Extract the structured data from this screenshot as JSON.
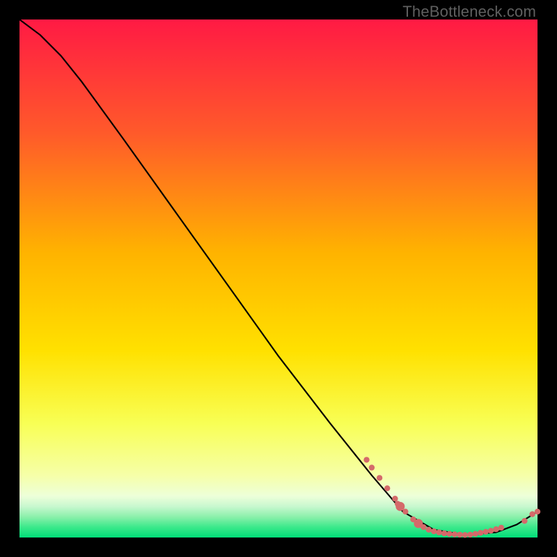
{
  "watermark": "TheBottleneck.com",
  "colors": {
    "top": "#ff1a44",
    "mid_upper": "#ff8a1f",
    "mid": "#ffd400",
    "mid_lower": "#f7ff5a",
    "pale": "#f4ffcf",
    "green_light": "#8ef5a4",
    "green": "#00e07a",
    "dot": "#d46a6a",
    "line": "#000000"
  },
  "chart_data": {
    "type": "line",
    "title": "",
    "xlabel": "",
    "ylabel": "",
    "xlim": [
      0,
      100
    ],
    "ylim": [
      0,
      100
    ],
    "curve": [
      {
        "x": 0,
        "y": 100
      },
      {
        "x": 4,
        "y": 97
      },
      {
        "x": 8,
        "y": 93
      },
      {
        "x": 12,
        "y": 88
      },
      {
        "x": 20,
        "y": 77
      },
      {
        "x": 30,
        "y": 63
      },
      {
        "x": 40,
        "y": 49
      },
      {
        "x": 50,
        "y": 35
      },
      {
        "x": 60,
        "y": 22
      },
      {
        "x": 68,
        "y": 12
      },
      {
        "x": 74,
        "y": 5
      },
      {
        "x": 80,
        "y": 1.5
      },
      {
        "x": 86,
        "y": 0.5
      },
      {
        "x": 92,
        "y": 1
      },
      {
        "x": 96,
        "y": 2.5
      },
      {
        "x": 100,
        "y": 5
      }
    ],
    "dots_small": [
      {
        "x": 67,
        "y": 15
      },
      {
        "x": 68,
        "y": 13.5
      },
      {
        "x": 69.5,
        "y": 11.5
      },
      {
        "x": 71,
        "y": 9.5
      },
      {
        "x": 72.5,
        "y": 7.5
      },
      {
        "x": 73,
        "y": 6.5
      },
      {
        "x": 74.5,
        "y": 5
      },
      {
        "x": 76,
        "y": 3.5
      },
      {
        "x": 78,
        "y": 2
      },
      {
        "x": 79,
        "y": 1.5
      },
      {
        "x": 80,
        "y": 1.2
      },
      {
        "x": 81,
        "y": 1
      },
      {
        "x": 82,
        "y": 0.8
      },
      {
        "x": 83,
        "y": 0.7
      },
      {
        "x": 84,
        "y": 0.6
      },
      {
        "x": 85,
        "y": 0.55
      },
      {
        "x": 86,
        "y": 0.5
      },
      {
        "x": 87,
        "y": 0.55
      },
      {
        "x": 88,
        "y": 0.7
      },
      {
        "x": 89,
        "y": 0.9
      },
      {
        "x": 90,
        "y": 1.1
      },
      {
        "x": 91,
        "y": 1.3
      },
      {
        "x": 92,
        "y": 1.6
      },
      {
        "x": 93,
        "y": 1.9
      },
      {
        "x": 97.5,
        "y": 3.2
      },
      {
        "x": 99,
        "y": 4.5
      },
      {
        "x": 100,
        "y": 5
      }
    ],
    "dots_large_extra": [
      {
        "x": 73.5,
        "y": 6
      },
      {
        "x": 77,
        "y": 2.7
      }
    ]
  }
}
